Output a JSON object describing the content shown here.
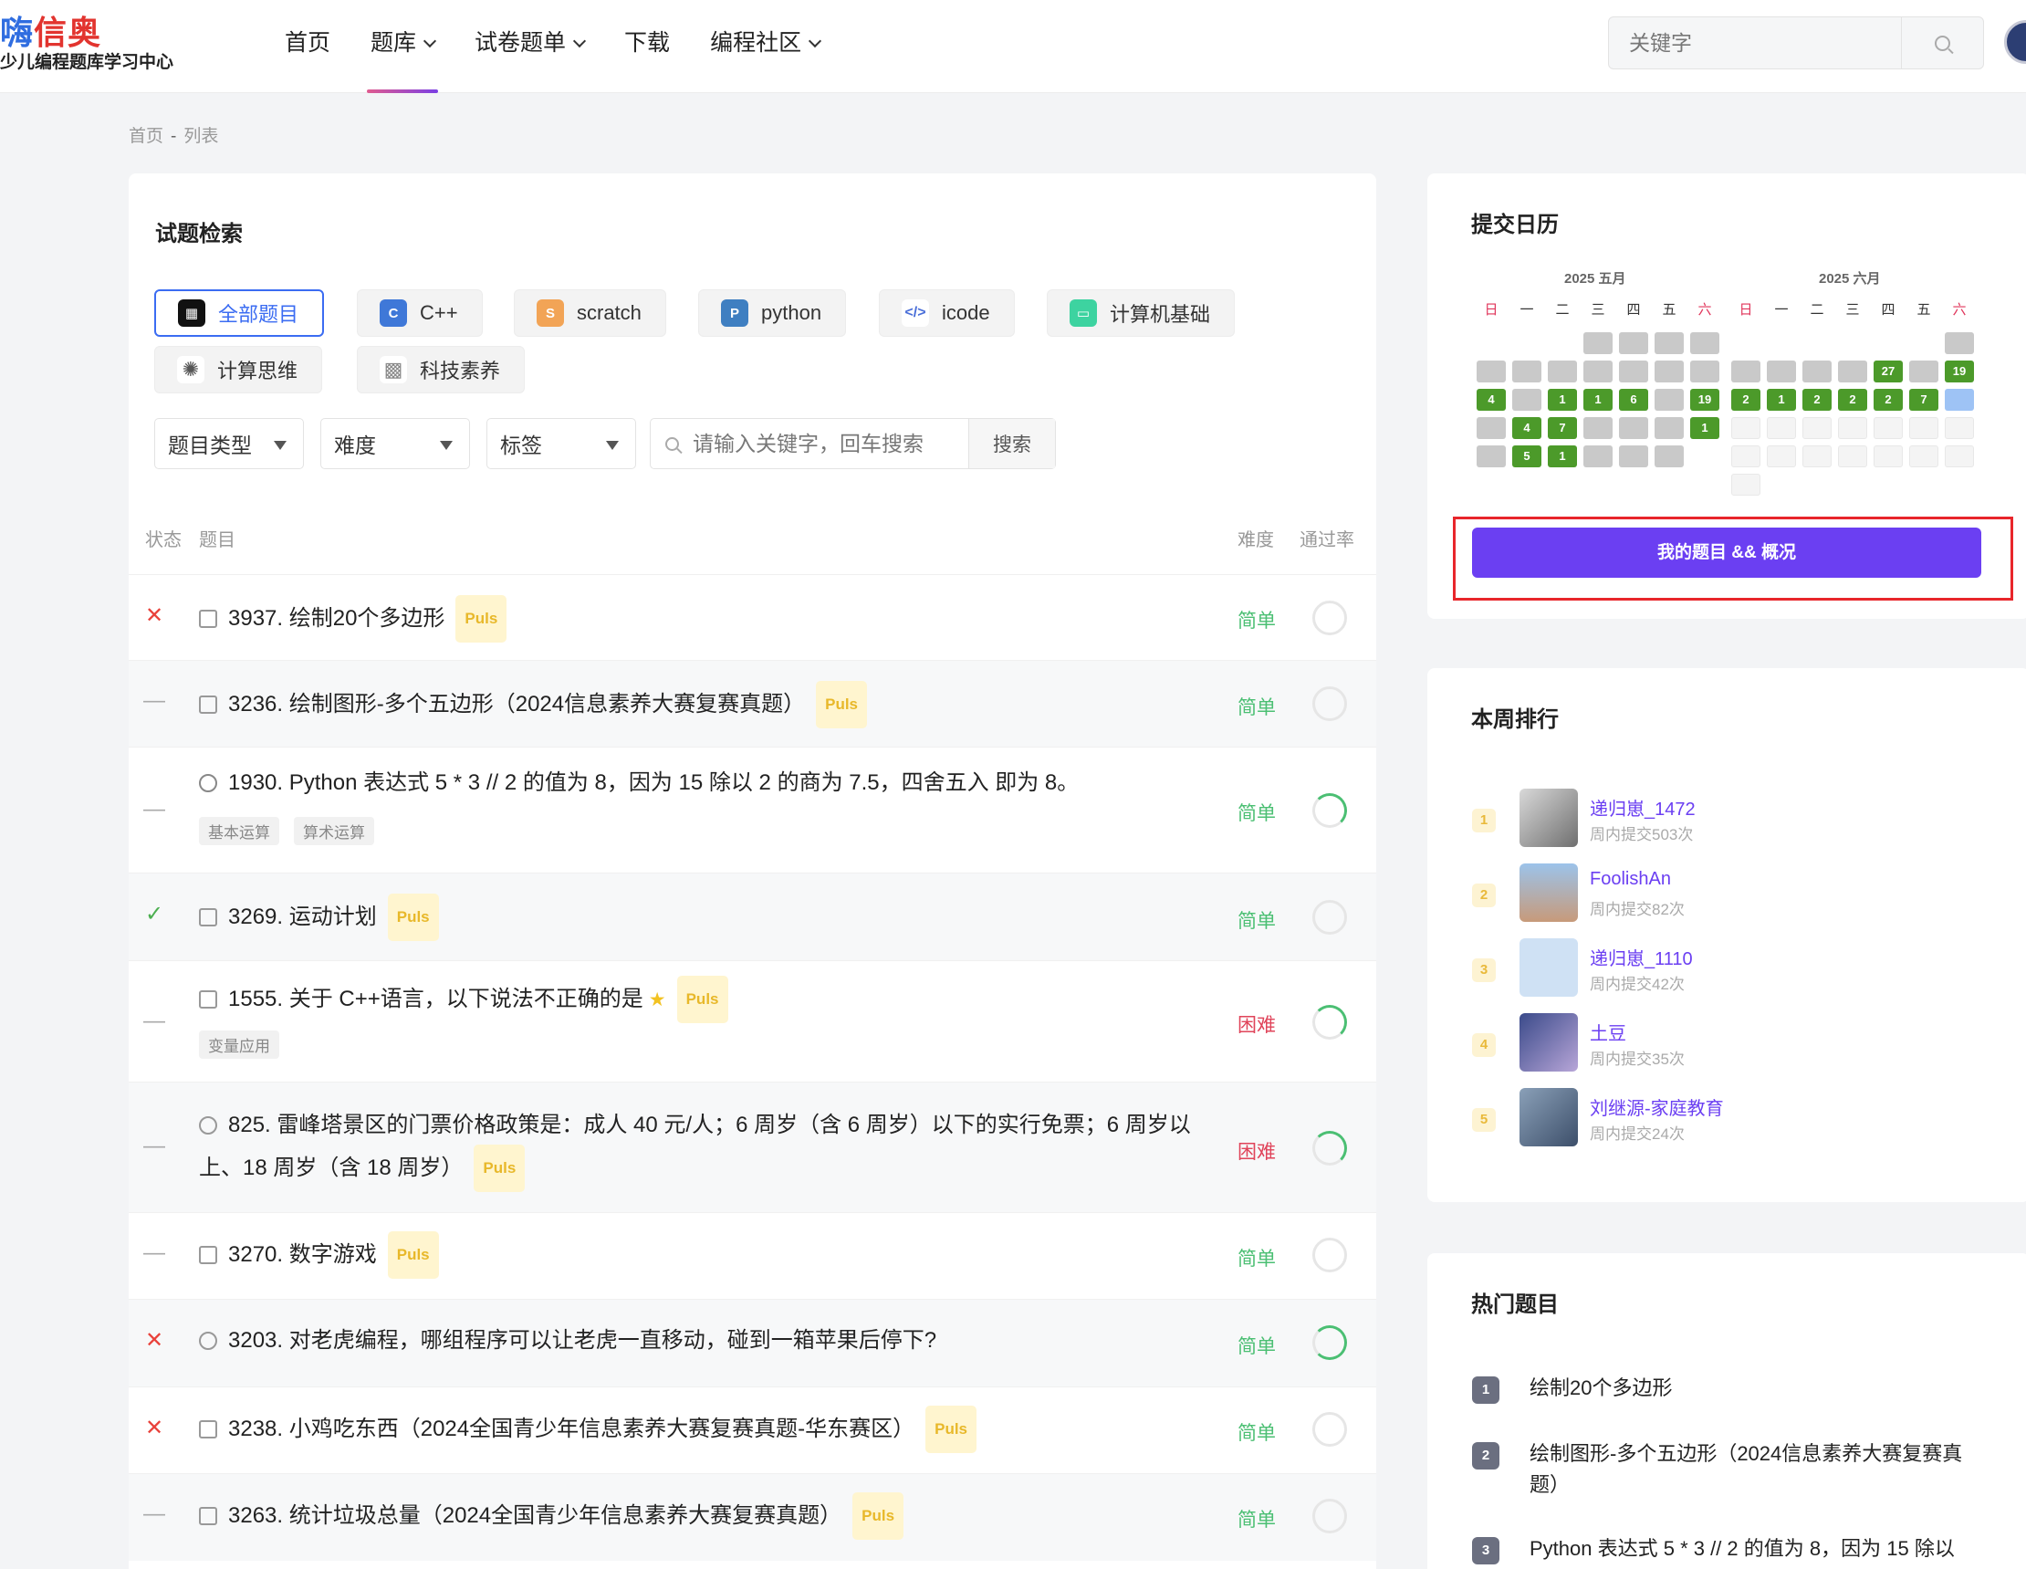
{
  "header": {
    "logo_title_a": "嗨",
    "logo_title_b": "信奥",
    "logo_subtitle": "少儿编程题库学习中心",
    "nav": [
      {
        "label": "首页",
        "dropdown": false,
        "active": false
      },
      {
        "label": "题库",
        "dropdown": true,
        "active": true
      },
      {
        "label": "试卷题单",
        "dropdown": true,
        "active": false
      },
      {
        "label": "下载",
        "dropdown": false,
        "active": false
      },
      {
        "label": "编程社区",
        "dropdown": true,
        "active": false
      }
    ],
    "search_placeholder": "关键字"
  },
  "breadcrumb": {
    "home": "首页",
    "sep": "-",
    "current": "列表"
  },
  "panel": {
    "title": "试题检索",
    "categories": [
      {
        "label": "全部题目",
        "icon": "grid-icon",
        "color": "#111111",
        "active": true
      },
      {
        "label": "C++",
        "icon": "cpp-icon",
        "color": "#3f78d8"
      },
      {
        "label": "scratch",
        "icon": "scratch-icon",
        "color": "#f2a456"
      },
      {
        "label": "python",
        "icon": "python-icon",
        "color": "#3f7fc1"
      },
      {
        "label": "icode",
        "icon": "code-icon",
        "color": "#4a6fd9"
      },
      {
        "label": "计算机基础",
        "icon": "monitor-icon",
        "color": "#3dd3a0"
      },
      {
        "label": "计算思维",
        "icon": "bulb-icon",
        "color": "#555555"
      },
      {
        "label": "科技素养",
        "icon": "chip-icon",
        "color": "#888888"
      }
    ],
    "filters": {
      "type_label": "题目类型",
      "difficulty_label": "难度",
      "tag_label": "标签",
      "keyword_placeholder": "请输入关键字，回车搜索",
      "search_button": "搜索"
    },
    "columns": {
      "status": "状态",
      "title": "题目",
      "difficulty": "难度",
      "pass_rate": "通过率"
    },
    "puls_label": "Puls",
    "rows": [
      {
        "status": "✕",
        "title": "3937. 绘制20个多边形",
        "puls": true,
        "difficulty": "简单"
      },
      {
        "status": "—",
        "title": "3236. 绘制图形-多个五边形（2024信息素养大赛复赛真题）",
        "puls": true,
        "difficulty": "简单"
      },
      {
        "status": "—",
        "title": "1930. Python 表达式 5 * 3 // 2 的值为 8，因为 15 除以 2 的商为 7.5，四舍五入 即为 8。",
        "tags": [
          "基本运算",
          "算术运算"
        ],
        "difficulty": "简单"
      },
      {
        "status": "✓",
        "title": "3269. 运动计划",
        "puls": true,
        "difficulty": "简单"
      },
      {
        "status": "—",
        "title": "1555. 关于 C++语言，以下说法不正确的是",
        "star": "★",
        "puls": true,
        "tags": [
          "变量应用"
        ],
        "difficulty": "困难"
      },
      {
        "status": "—",
        "title": "825. 雷峰塔景区的门票价格政策是：成人 40 元/人；6 周岁（含 6 周岁）以下的实行免票；6 周岁以上、18 周岁（含 18 周岁）",
        "puls": true,
        "difficulty": "困难"
      },
      {
        "status": "—",
        "title": "3270. 数字游戏",
        "puls": true,
        "difficulty": "简单"
      },
      {
        "status": "✕",
        "title": "3203. 对老虎编程，哪组程序可以让老虎一直移动，碰到一箱苹果后停下?",
        "difficulty": "简单"
      },
      {
        "status": "✕",
        "title": "3238. 小鸡吃东西（2024全国青少年信息素养大赛复赛真题-华东赛区）",
        "puls": true,
        "difficulty": "简单"
      },
      {
        "status": "—",
        "title": "3263. 统计垃圾总量（2024全国青少年信息素养大赛复赛真题）",
        "puls": true,
        "difficulty": "简单"
      }
    ]
  },
  "calendar": {
    "title": "提交日历",
    "months": [
      "2025 五月",
      "2025 六月"
    ],
    "weekdays": [
      "日",
      "一",
      "二",
      "三",
      "四",
      "五",
      "六"
    ],
    "may_counts": [
      "4",
      "1",
      "1",
      "6",
      "19",
      "4",
      "7",
      "1",
      "5",
      "1"
    ],
    "june_counts": [
      "27",
      "19",
      "2",
      "1",
      "2",
      "2",
      "2",
      "7"
    ],
    "my_button": "我的题目 && 概况"
  },
  "ranking": {
    "title": "本周排行",
    "items": [
      {
        "rank": "1",
        "name": "递归崽_1472",
        "sub": "周内提交503次"
      },
      {
        "rank": "2",
        "name": "FoolishAn",
        "sub": "周内提交82次"
      },
      {
        "rank": "3",
        "name": "递归崽_1110",
        "sub": "周内提交42次"
      },
      {
        "rank": "4",
        "name": "土豆",
        "sub": "周内提交35次"
      },
      {
        "rank": "5",
        "name": "刘继源-家庭教育",
        "sub": "周内提交24次"
      }
    ]
  },
  "hot": {
    "title": "热门题目",
    "items": [
      {
        "rank": "1",
        "title": "绘制20个多边形"
      },
      {
        "rank": "2",
        "title": "绘制图形-多个五边形（2024信息素养大赛复赛真题）"
      },
      {
        "rank": "3",
        "title": "Python 表达式 5 * 3 // 2 的值为 8，因为 15 除以"
      }
    ]
  },
  "colors": {
    "accent": "#6b3ff2",
    "easy": "#4bbf73",
    "hard": "#e0445a",
    "calendar_green": "#4c9a2a"
  }
}
